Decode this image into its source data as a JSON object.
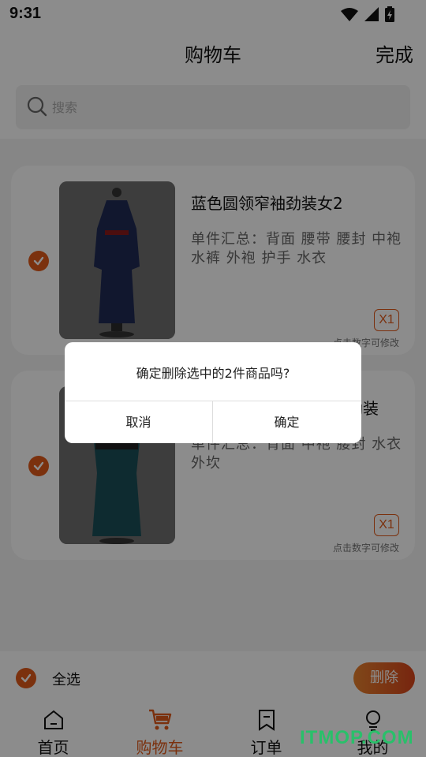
{
  "status": {
    "time": "9:31"
  },
  "header": {
    "title": "购物车",
    "done_label": "完成"
  },
  "search": {
    "placeholder": "搜索"
  },
  "items": [
    {
      "name": "蓝色圆领窄袖劲装女2",
      "summary": "单件汇总：背面 腰带 腰封 中袍 水裤 外袍 护手 水衣",
      "qty": "X1",
      "qty_hint": "点击数字可修改",
      "checked": true
    },
    {
      "name": "劲装",
      "summary": "单件汇总：背面 中袍 腰封 水衣 外坎",
      "qty": "X1",
      "qty_hint": "点击数字可修改",
      "checked": true
    }
  ],
  "footer": {
    "select_all_label": "全选",
    "delete_label": "删除"
  },
  "tabs": [
    {
      "label": "首页",
      "icon": "home-icon",
      "active": false
    },
    {
      "label": "购物车",
      "icon": "cart-icon",
      "active": true
    },
    {
      "label": "订单",
      "icon": "bookmark-icon",
      "active": false
    },
    {
      "label": "我的",
      "icon": "bulb-icon",
      "active": false
    }
  ],
  "dialog": {
    "message": "确定删除选中的2件商品吗?",
    "cancel_label": "取消",
    "confirm_label": "确定"
  },
  "watermark": "ITMOP.COM",
  "colors": {
    "accent": "#e05a1a",
    "watermark": "#29c06a"
  }
}
